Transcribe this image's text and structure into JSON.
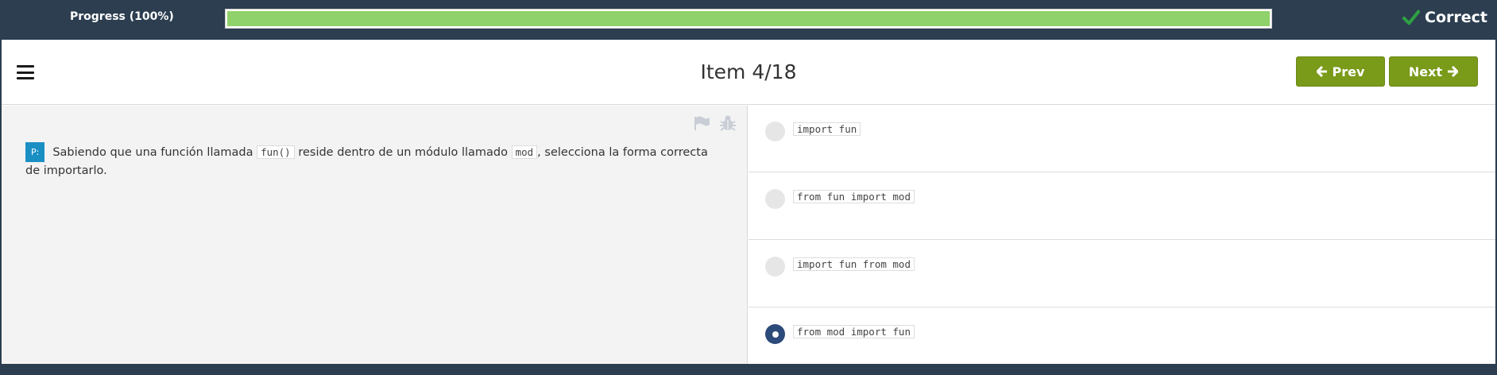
{
  "progress": {
    "label": "Progress (100%)",
    "fraction": 1.0
  },
  "status": {
    "label": "Correct",
    "icon": "check-icon",
    "icon_color": "#2ea043"
  },
  "header": {
    "menu_icon": "hamburger-icon",
    "title": "Item 4/18",
    "prev_label": "Prev",
    "next_label": "Next"
  },
  "colors": {
    "accent": "#7a9a1a",
    "topbar": "#2c3e50",
    "progress_fill": "#8fd16a",
    "badge": "#1a8fc4",
    "radio_selected": "#2c4a7a"
  },
  "question": {
    "badge": "P:",
    "text_1": "Sabiendo que una función llamada",
    "code_1": "fun()",
    "text_2": "reside dentro de un módulo llamado",
    "code_2": "mod",
    "text_3": ", selecciona la forma correcta de importarlo.",
    "icons": [
      "flag-icon",
      "bug-icon"
    ]
  },
  "options": [
    {
      "code": "import fun",
      "selected": false
    },
    {
      "code": "from fun import mod",
      "selected": false
    },
    {
      "code": "import fun from mod",
      "selected": false
    },
    {
      "code": "from mod import fun",
      "selected": true
    }
  ]
}
